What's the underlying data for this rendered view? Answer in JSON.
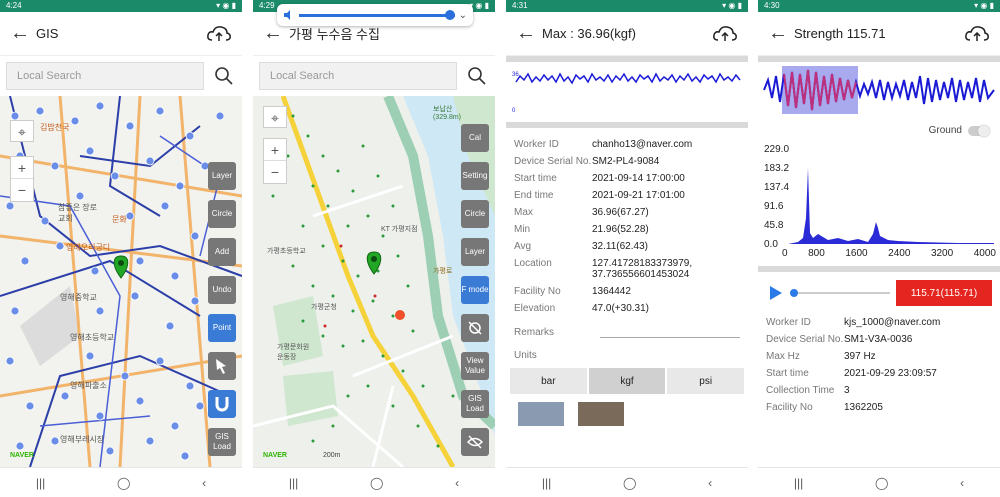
{
  "phones": [
    {
      "time": "4:24",
      "title": "GIS",
      "search_placeholder": "Local Search",
      "buttons": [
        "Layer",
        "Circle",
        "Add",
        "Undo",
        "Point",
        "",
        "",
        "GIS Load"
      ],
      "map_labels": [
        "김밥천국",
        "참좋은 장로교회",
        "영해오리궁디",
        "문화",
        "영해중학교",
        "영해초등학교",
        "영해파출소",
        "영해부레시장"
      ],
      "naver": "NAVER"
    },
    {
      "time": "4:29",
      "title": "가평 누수음 수집",
      "search_placeholder": "Local Search",
      "buttons": [
        "Cal",
        "Setting",
        "Circle",
        "Layer",
        "F mode",
        "",
        "View Value",
        "GIS Load",
        ""
      ],
      "map_labels": [
        "보납산 (329.8m)",
        "가평초등학교",
        "KT 가평지점",
        "가평군청",
        "가평로",
        "가평문화원 운동장"
      ],
      "naver": "NAVER",
      "scale": "200m"
    },
    {
      "time": "4:31",
      "title": "Max : 36.96(kgf)",
      "chart_mark_top": "36",
      "chart_mark_bottom": "0",
      "fields": [
        {
          "k": "Worker ID",
          "v": "chanho13@naver.com"
        },
        {
          "k": "Device Serial No.",
          "v": "SM2-PL4-9084"
        },
        {
          "k": "Start time",
          "v": "2021-09-14 17:00:00"
        },
        {
          "k": "End time",
          "v": "2021-09-21 17:01:00"
        },
        {
          "k": "Max",
          "v": "36.96(67.27)"
        },
        {
          "k": "Min",
          "v": "21.96(52.28)"
        },
        {
          "k": "Avg",
          "v": "32.11(62.43)"
        },
        {
          "k": "Location",
          "v": "127.41728183373979, 37.736556601453024"
        },
        {
          "k": "Facility No",
          "v": "1364442"
        },
        {
          "k": "Elevation",
          "v": "47.0(+30.31)"
        }
      ],
      "remarks_label": "Remarks",
      "units_label": "Units",
      "units": [
        "bar",
        "kgf",
        "psi"
      ],
      "unit_selected": "kgf"
    },
    {
      "time": "4:30",
      "title": "Strength 115.71",
      "ground_label": "Ground",
      "y_ticks": [
        "229.0",
        "183.2",
        "137.4",
        "91.6",
        "45.8",
        "0.0"
      ],
      "x_ticks": [
        "0",
        "800",
        "1600",
        "2400",
        "3200",
        "4000"
      ],
      "value_button": "115.71(115.71)",
      "fields": [
        {
          "k": "Worker ID",
          "v": "kjs_1000@naver.com"
        },
        {
          "k": "Device Serial No.",
          "v": "SM1-V3A-0036"
        },
        {
          "k": "Max Hz",
          "v": "397 Hz"
        },
        {
          "k": "Start time",
          "v": "2021-09-29 23:09:57"
        },
        {
          "k": "Collection Time",
          "v": "3"
        },
        {
          "k": "Facility No",
          "v": "1362205"
        }
      ]
    }
  ],
  "colors": {
    "statusbar": "#1a8a68",
    "accent_red": "#e52620",
    "wave_blue": "#1a1ad6",
    "wave_magenta": "#c0307a"
  }
}
